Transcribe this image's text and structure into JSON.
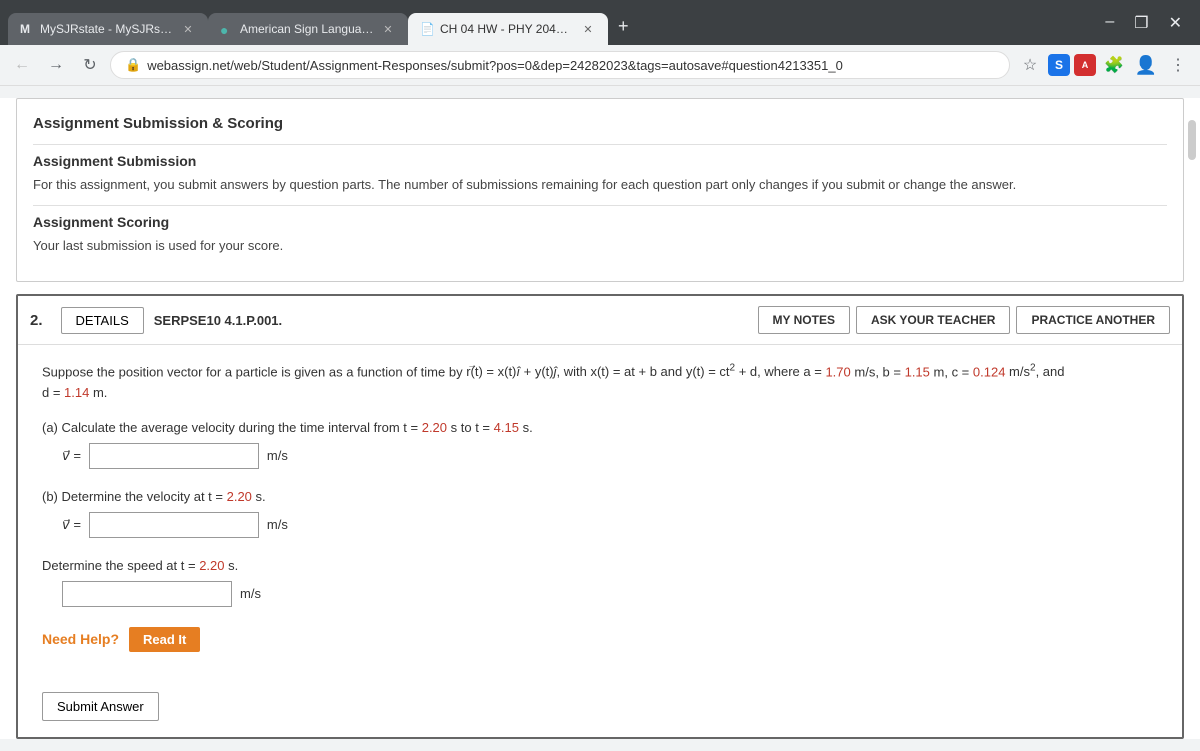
{
  "browser": {
    "tabs": [
      {
        "id": "tab1",
        "label": "MySJRstate - MySJRstate",
        "favicon": "M",
        "active": false
      },
      {
        "id": "tab2",
        "label": "American Sign Language I-11047",
        "favicon": "●",
        "active": false
      },
      {
        "id": "tab3",
        "label": "CH 04 HW - PHY 2048, section X",
        "favicon": "📄",
        "active": true
      }
    ],
    "url": "webassign.net/web/Student/Assignment-Responses/submit?pos=0&dep=24282023&tags=autosave#question4213351_0",
    "new_tab_icon": "+",
    "window_controls": [
      "–",
      "❐",
      "✕"
    ]
  },
  "info_panel": {
    "title": "Assignment Submission & Scoring",
    "submission_heading": "Assignment Submission",
    "submission_text": "For this assignment, you submit answers by question parts. The number of submissions remaining for each question part only changes if you submit or change the answer.",
    "scoring_heading": "Assignment Scoring",
    "scoring_text": "Your last submission is used for your score."
  },
  "question": {
    "number": "2.",
    "details_label": "DETAILS",
    "id": "SERPSE10 4.1.P.001.",
    "buttons": {
      "my_notes": "MY NOTES",
      "ask_teacher": "ASK YOUR TEACHER",
      "practice": "PRACTICE ANOTHER"
    },
    "problem_text_parts": {
      "intro": "Suppose the position vector for a particle is given as a function of time by ",
      "r_vec": "r",
      "r_eq": "(t) = x(t)",
      "i_hat": "î",
      "plus": " + y(t)",
      "j_hat": "ĵ",
      "comma": ", with x(t) = at + b and y(t) = ct",
      "sq": "2",
      "plus_d": " + d, where a = ",
      "a_val": "1.70",
      "a_unit": " m/s, b = ",
      "b_val": "1.15",
      "b_unit": " m, c = ",
      "c_val": "0.124",
      "c_unit": " m/s",
      "c_sq": "2",
      "and": ", and",
      "d_intro": "d = ",
      "d_val": "1.14",
      "d_unit": " m."
    },
    "part_a": {
      "label": "(a) Calculate the average velocity during the time interval from t = ",
      "t1_val": "2.20",
      "t1_unit": " s to t = ",
      "t2_val": "4.15",
      "t2_unit": " s.",
      "input_label": "v⃗ =",
      "unit": "m/s"
    },
    "part_b": {
      "label": "(b) Determine the velocity at t = ",
      "t_val": "2.20",
      "t_unit": " s.",
      "input_label": "v⃗ =",
      "unit": "m/s"
    },
    "part_c": {
      "label": "Determine the speed at t = ",
      "t_val": "2.20",
      "t_unit": " s.",
      "unit": "m/s"
    },
    "need_help": {
      "text": "Need Help?",
      "read_it_label": "Read It"
    },
    "submit_label": "Submit Answer"
  }
}
